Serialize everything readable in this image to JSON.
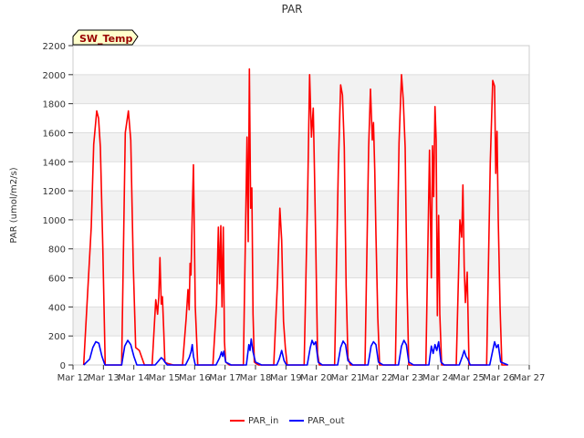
{
  "chart_data": {
    "type": "line",
    "title": "PAR",
    "ylabel": "PAR (umol/m2/s)",
    "xlabel": "",
    "badge": "SW_Temp",
    "ylim": [
      0,
      2200
    ],
    "yticks": [
      0,
      200,
      400,
      600,
      800,
      1000,
      1200,
      1400,
      1600,
      1800,
      2000,
      2200
    ],
    "xlim": [
      0,
      15
    ],
    "xticks": [
      {
        "v": 0,
        "label": "Mar 12"
      },
      {
        "v": 1,
        "label": "Mar 13"
      },
      {
        "v": 2,
        "label": "Mar 14"
      },
      {
        "v": 3,
        "label": "Mar 15"
      },
      {
        "v": 4,
        "label": "Mar 16"
      },
      {
        "v": 5,
        "label": "Mar 17"
      },
      {
        "v": 6,
        "label": "Mar 18"
      },
      {
        "v": 7,
        "label": "Mar 19"
      },
      {
        "v": 8,
        "label": "Mar 20"
      },
      {
        "v": 9,
        "label": "Mar 21"
      },
      {
        "v": 10,
        "label": "Mar 22"
      },
      {
        "v": 11,
        "label": "Mar 23"
      },
      {
        "v": 12,
        "label": "Mar 24"
      },
      {
        "v": 13,
        "label": "Mar 25"
      },
      {
        "v": 14,
        "label": "Mar 26"
      },
      {
        "v": 15,
        "label": "Mar 27"
      }
    ],
    "grid": true,
    "banded_background": true,
    "legend_position": "bottom-center",
    "series": [
      {
        "name": "PAR_in",
        "color": "#ff0000",
        "x": [
          0.35,
          0.6,
          0.68,
          0.78,
          0.84,
          0.9,
          0.98,
          1.06,
          1.18,
          1.3,
          1.6,
          1.72,
          1.82,
          1.9,
          1.98,
          2.06,
          2.18,
          2.35,
          2.6,
          2.72,
          2.78,
          2.82,
          2.86,
          2.9,
          2.94,
          2.98,
          3.02,
          3.06,
          3.12,
          3.3,
          3.6,
          3.72,
          3.78,
          3.82,
          3.85,
          3.88,
          3.92,
          3.96,
          4.02,
          4.1,
          4.2,
          4.4,
          4.6,
          4.72,
          4.78,
          4.82,
          4.86,
          4.9,
          4.94,
          4.98,
          5.02,
          5.08,
          5.14,
          5.3,
          5.6,
          5.72,
          5.76,
          5.8,
          5.84,
          5.88,
          5.92,
          5.96,
          6.02,
          6.1,
          6.2,
          6.4,
          6.6,
          6.72,
          6.8,
          6.86,
          6.92,
          6.98,
          7.04,
          7.1,
          7.2,
          7.4,
          7.6,
          7.72,
          7.78,
          7.84,
          7.9,
          7.94,
          7.98,
          8.04,
          8.1,
          8.2,
          8.4,
          8.6,
          8.72,
          8.8,
          8.86,
          8.92,
          8.98,
          9.04,
          9.12,
          9.2,
          9.4,
          9.6,
          9.72,
          9.78,
          9.84,
          9.88,
          9.92,
          9.96,
          10.02,
          10.08,
          10.2,
          10.4,
          10.6,
          10.72,
          10.8,
          10.86,
          10.92,
          10.98,
          11.04,
          11.12,
          11.2,
          11.4,
          11.6,
          11.72,
          11.78,
          11.82,
          11.86,
          11.9,
          11.94,
          11.98,
          12.02,
          12.06,
          12.12,
          12.2,
          12.4,
          12.6,
          12.72,
          12.78,
          12.82,
          12.86,
          12.9,
          12.96,
          13.02,
          13.1,
          13.2,
          13.4,
          13.6,
          13.72,
          13.8,
          13.86,
          13.9,
          13.94,
          13.98,
          14.04,
          14.1,
          14.2,
          14.3
        ],
        "y": [
          0,
          950,
          1520,
          1750,
          1700,
          1500,
          800,
          0,
          0,
          0,
          0,
          1600,
          1750,
          1550,
          700,
          120,
          100,
          0,
          0,
          450,
          350,
          470,
          740,
          420,
          470,
          260,
          20,
          15,
          10,
          0,
          0,
          320,
          520,
          380,
          700,
          620,
          1040,
          1380,
          400,
          0,
          0,
          0,
          0,
          420,
          950,
          560,
          960,
          400,
          950,
          160,
          20,
          10,
          0,
          0,
          0,
          1570,
          850,
          2040,
          1080,
          1220,
          350,
          20,
          10,
          0,
          0,
          0,
          0,
          560,
          1080,
          860,
          300,
          120,
          0,
          0,
          0,
          0,
          0,
          1230,
          2000,
          1570,
          1770,
          1310,
          850,
          80,
          0,
          0,
          0,
          0,
          1340,
          1930,
          1860,
          1500,
          550,
          50,
          0,
          0,
          0,
          0,
          1500,
          1900,
          1550,
          1670,
          1340,
          900,
          330,
          0,
          0,
          0,
          0,
          1530,
          2000,
          1820,
          1500,
          550,
          0,
          0,
          0,
          0,
          0,
          1480,
          600,
          1510,
          1160,
          1780,
          1550,
          340,
          1030,
          350,
          0,
          0,
          0,
          0,
          1000,
          880,
          1240,
          680,
          430,
          640,
          0,
          0,
          0,
          0,
          0,
          1400,
          1960,
          1920,
          1320,
          1610,
          1010,
          400,
          0,
          0,
          0
        ]
      },
      {
        "name": "PAR_out",
        "color": "#0000ff",
        "x": [
          0.35,
          0.55,
          0.65,
          0.75,
          0.85,
          0.95,
          1.05,
          1.2,
          1.6,
          1.7,
          1.8,
          1.9,
          2.0,
          2.1,
          2.3,
          2.7,
          2.82,
          2.9,
          2.96,
          3.02,
          3.1,
          3.3,
          3.7,
          3.82,
          3.88,
          3.92,
          3.96,
          4.02,
          4.2,
          4.7,
          4.82,
          4.88,
          4.92,
          4.96,
          5.02,
          5.2,
          5.7,
          5.78,
          5.82,
          5.86,
          5.92,
          6.0,
          6.2,
          6.7,
          6.78,
          6.86,
          6.94,
          7.02,
          7.2,
          7.7,
          7.8,
          7.86,
          7.92,
          7.98,
          8.06,
          8.2,
          8.7,
          8.8,
          8.88,
          8.96,
          9.04,
          9.2,
          9.7,
          9.8,
          9.88,
          9.96,
          10.04,
          10.2,
          10.7,
          10.8,
          10.88,
          10.96,
          11.04,
          11.2,
          11.7,
          11.78,
          11.84,
          11.9,
          11.96,
          12.02,
          12.1,
          12.2,
          12.7,
          12.8,
          12.86,
          12.92,
          12.98,
          13.06,
          13.2,
          13.7,
          13.8,
          13.86,
          13.92,
          13.98,
          14.06,
          14.3
        ],
        "y": [
          0,
          40,
          120,
          160,
          150,
          60,
          0,
          0,
          0,
          130,
          170,
          140,
          60,
          0,
          0,
          0,
          30,
          50,
          40,
          20,
          0,
          0,
          0,
          50,
          90,
          140,
          60,
          0,
          0,
          0,
          50,
          90,
          60,
          95,
          20,
          0,
          0,
          140,
          100,
          180,
          90,
          20,
          0,
          0,
          40,
          100,
          30,
          0,
          0,
          0,
          120,
          170,
          140,
          160,
          20,
          0,
          0,
          120,
          165,
          140,
          30,
          0,
          0,
          130,
          160,
          140,
          20,
          0,
          0,
          130,
          170,
          140,
          20,
          0,
          0,
          130,
          80,
          140,
          100,
          160,
          20,
          0,
          0,
          60,
          100,
          60,
          40,
          0,
          0,
          0,
          100,
          160,
          120,
          140,
          20,
          0
        ]
      }
    ]
  }
}
